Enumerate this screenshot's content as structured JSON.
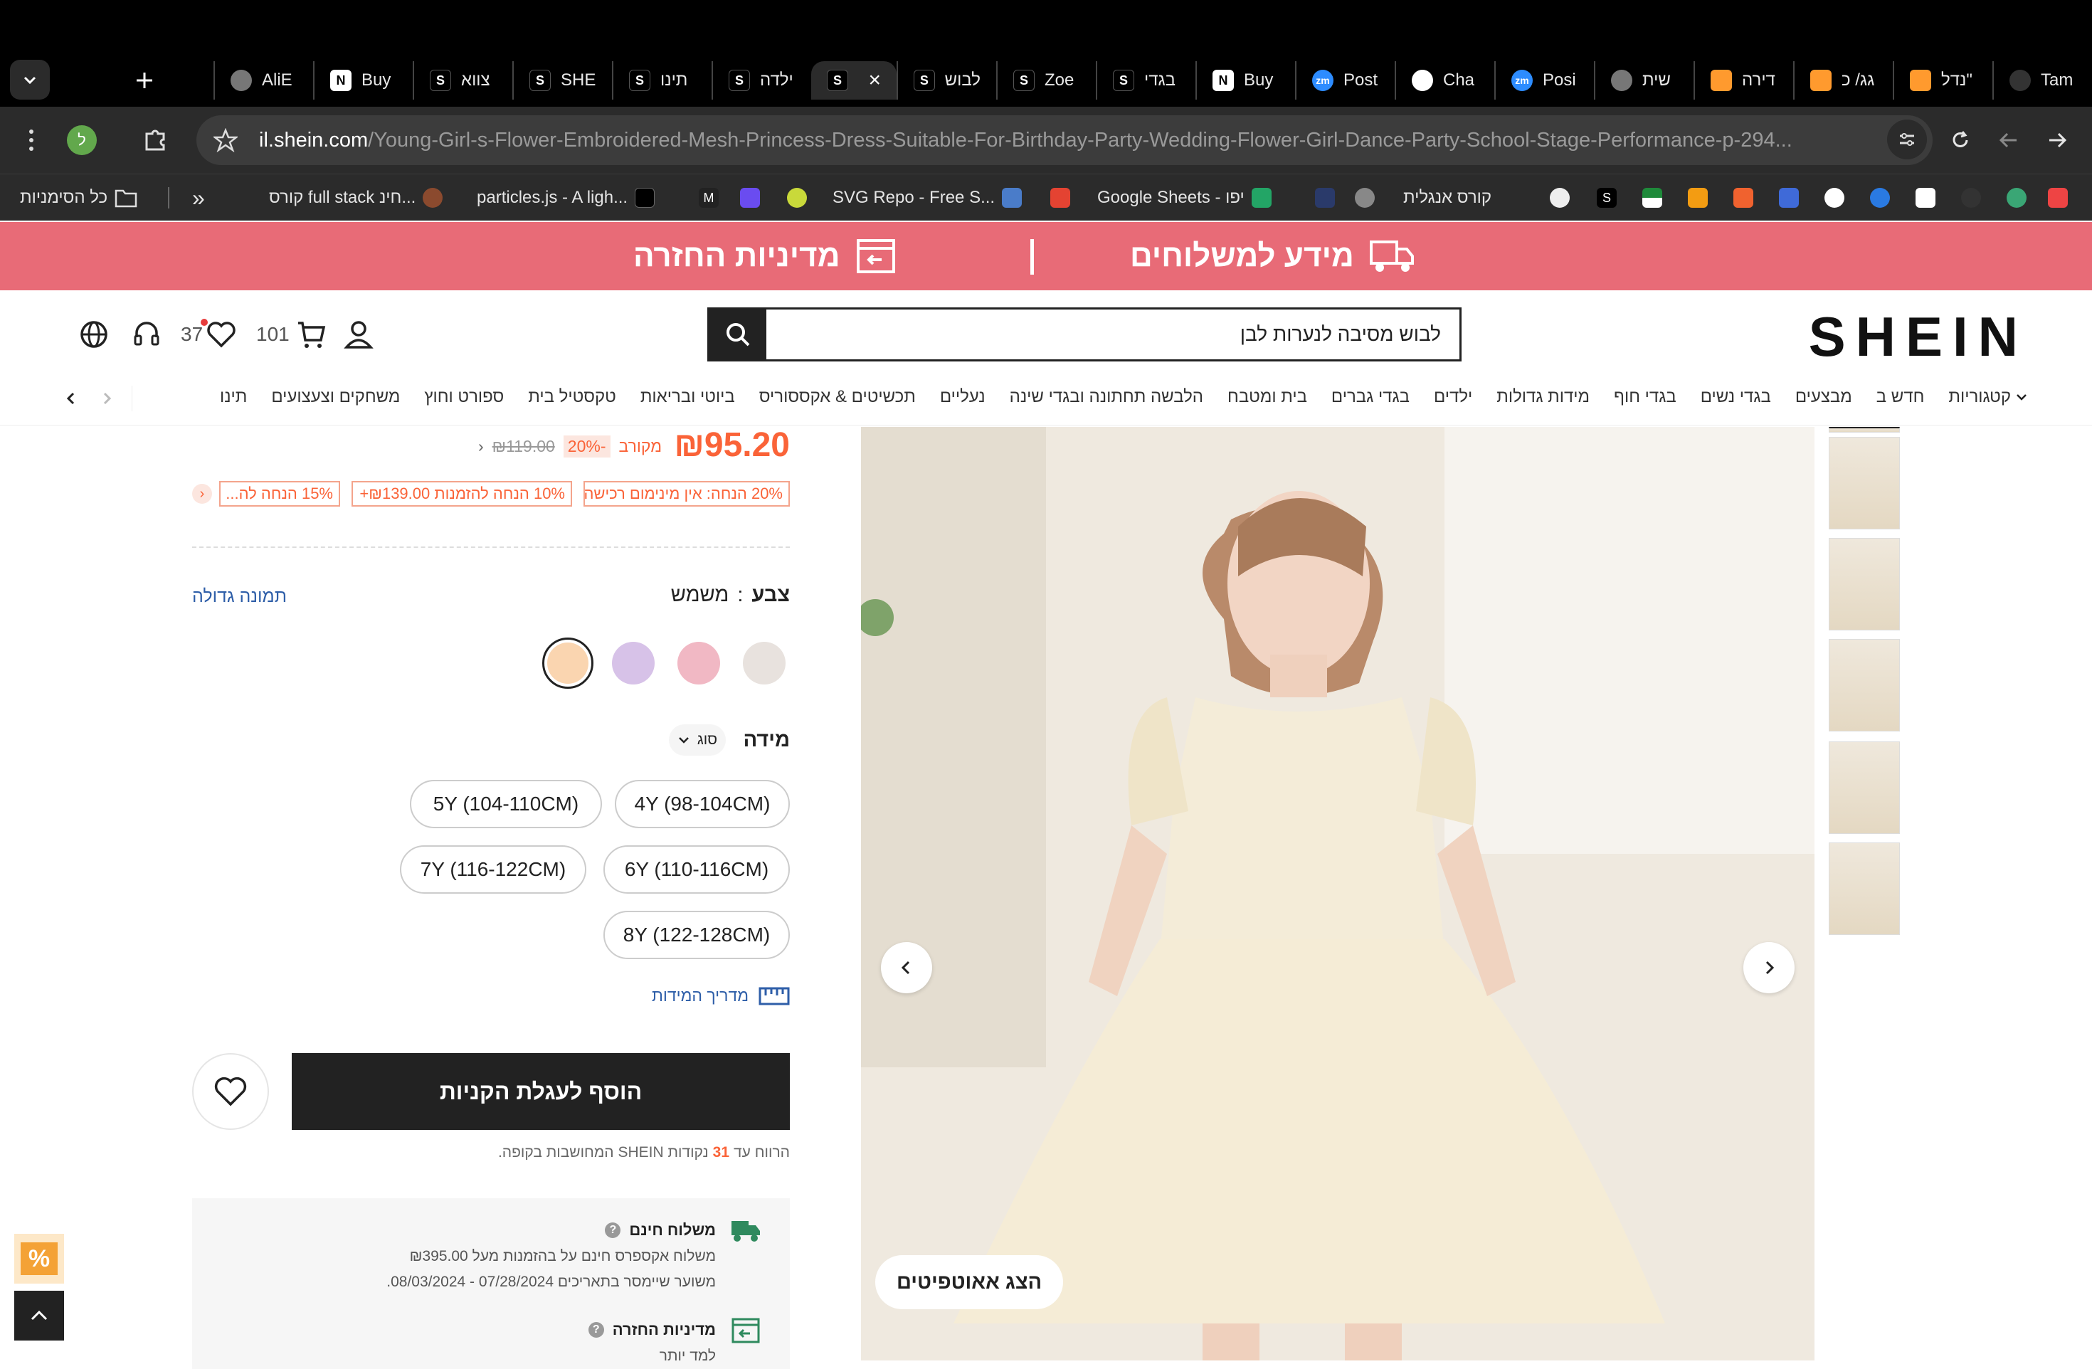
{
  "browser": {
    "tabs": [
      {
        "label": "Tam",
        "icon": "github-icon",
        "color": "#333"
      },
      {
        "label": "נדל\"",
        "icon": "bonbon-icon",
        "color": "#ff9a2e"
      },
      {
        "label": "גג/ כ",
        "icon": "bonbon-icon",
        "color": "#ff9a2e"
      },
      {
        "label": "דירה",
        "icon": "bonbon-icon",
        "color": "#ff9a2e"
      },
      {
        "label": "שית",
        "icon": "globe-icon",
        "color": "#777"
      },
      {
        "label": "Posi",
        "icon": "zoom-icon",
        "color": "#2d8cff"
      },
      {
        "label": "Cha",
        "icon": "openai-icon",
        "color": "#fff"
      },
      {
        "label": "Post",
        "icon": "zoom-icon",
        "color": "#2d8cff"
      },
      {
        "label": "Buy",
        "icon": "notion-icon",
        "color": "#fff"
      },
      {
        "label": "בגדי",
        "icon": "shein-icon",
        "color": "#000"
      },
      {
        "label": "Zoe",
        "icon": "shein-icon",
        "color": "#000"
      },
      {
        "label": "לבוש",
        "icon": "shein-icon",
        "color": "#000"
      },
      {
        "label": "",
        "icon": "shein-icon",
        "color": "#000",
        "active": true
      },
      {
        "label": "ילדה",
        "icon": "shein-icon",
        "color": "#000"
      },
      {
        "label": "תינו",
        "icon": "shein-icon",
        "color": "#000"
      },
      {
        "label": "SHE",
        "icon": "shein-icon",
        "color": "#000"
      },
      {
        "label": "צווא",
        "icon": "shein-icon",
        "color": "#000"
      },
      {
        "label": "Buy",
        "icon": "notion-icon",
        "color": "#fff"
      },
      {
        "label": "AliE",
        "icon": "globe-icon",
        "color": "#777"
      }
    ],
    "url_host": "il.shein.com",
    "url_path": "/Young-Girl-s-Flower-Embroidered-Mesh-Princess-Dress-Suitable-For-Birthday-Party-Wedding-Flower-Girl-Dance-Party-School-Stage-Performance-p-294...",
    "profile_letter": "ל",
    "bookmarks": {
      "all": "כל הסימניות",
      "b1": "קורס full stack חינ...",
      "b2": "particles.js - A ligh...",
      "b3": "SVG Repo - Free S...",
      "b4": "Google Sheets - יפו",
      "b5": "קורס אנגלית"
    }
  },
  "banner": {
    "shipping": "מידע למשלוחים",
    "returns": "מדיניות החזרה"
  },
  "header": {
    "logo": "SHEIN",
    "search_value": "לבוש מסיבה לנערות לבן",
    "cart_count": "101",
    "wishlist_count": "37",
    "nav": [
      "קטגוריות",
      "חדש ב",
      "מבצעים",
      "בגדי נשים",
      "בגדי חוף",
      "מידות גדולות",
      "ילדים",
      "בגדי גברים",
      "בית ומטבח",
      "הלבשה תחתונה ובגדי שינה",
      "נעליים",
      "תכשיטים & אקססוריס",
      "ביוטי ובריאות",
      "טקסטיל בית",
      "ספורט וחוץ",
      "משחקים וצעצועים",
      "תינו"
    ]
  },
  "product": {
    "price": "₪95.20",
    "original_label": "מקורב",
    "discount": "-20%",
    "original_price": "₪119.00",
    "coupons": [
      "20% הנחה: אין מינימום רכישה",
      "10% הנחה להזמנות ₪139.00+",
      "15% הנחה לה..."
    ],
    "color_label": "צבע",
    "color_value": "משמש",
    "big_image": "תמונה גדולה",
    "swatch_colors": [
      "#fad5b0",
      "#d7c2e8",
      "#f1b8c4",
      "#e8e2de"
    ],
    "size_label": "מידה",
    "size_type": "סוג",
    "sizes": [
      "4Y (98-104CM)",
      "5Y (104-110CM)",
      "6Y (110-116CM)",
      "7Y (116-122CM)",
      "8Y (122-128CM)"
    ],
    "size_guide": "מדריך המידות",
    "add_to_cart": "הוסף לעגלת הקניות",
    "points_pre": "הרווח עד",
    "points_value": "31",
    "points_post": "נקודות SHEIN המחושבות בקופה.",
    "free_shipping_title": "משלוח חינם",
    "free_shipping_desc": "משלוח אקספרס חינם על בהזמנות מעל ₪395.00",
    "estimated": "משוער שיימסר בתאריכים 07/28/2024 - 08/03/2024.",
    "returns_title": "מדיניות החזרה",
    "learn_more": "למד יותר",
    "outfits_button": "הצג אאוטפיטים"
  },
  "colors": {
    "accent": "#fa6338",
    "banner": "#e86b77",
    "dark": "#222222"
  }
}
